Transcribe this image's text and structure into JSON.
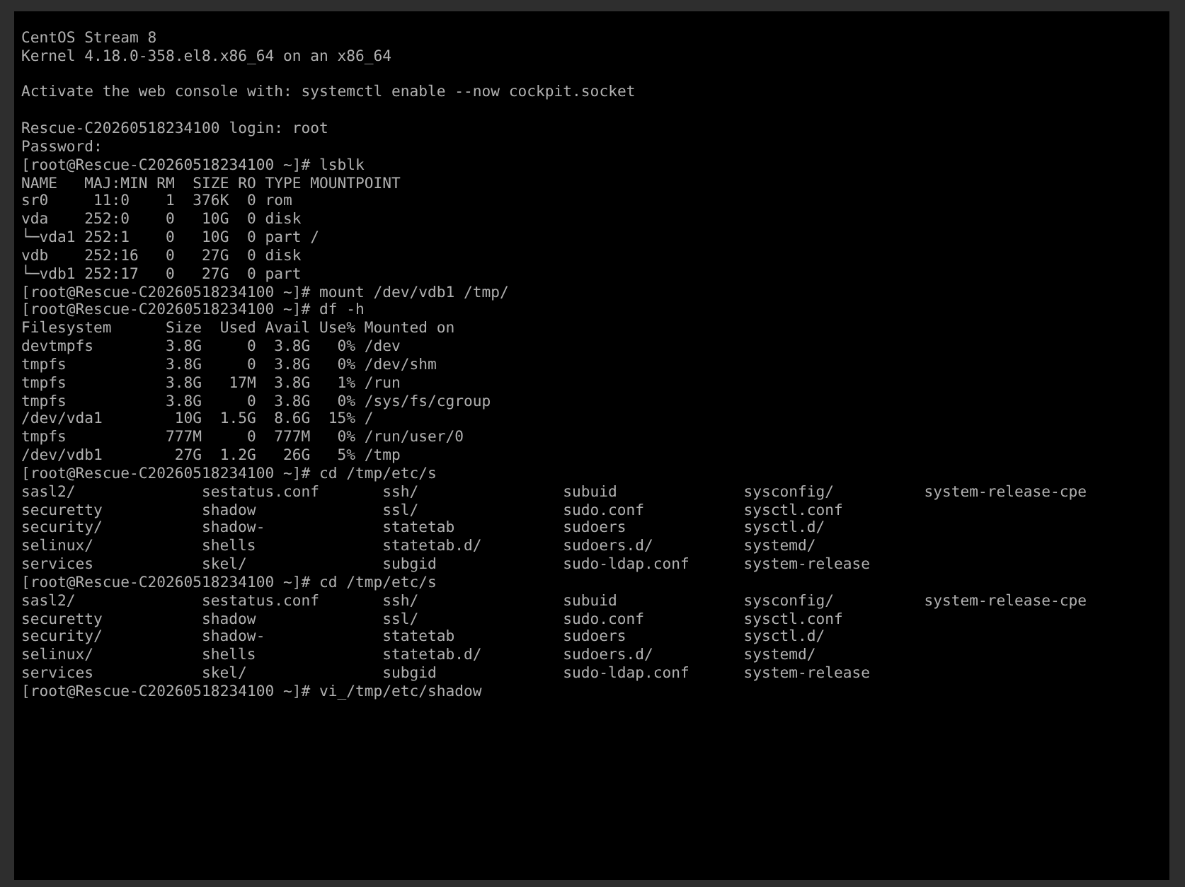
{
  "terminal": {
    "blocks": [
      [
        {
          "kind": "text",
          "text": "CentOS Stream 8"
        },
        {
          "kind": "text",
          "text": "Kernel 4.18.0-358.el8.x86_64 on an x86_64"
        }
      ],
      [
        {
          "kind": "text",
          "text": "Activate the web console with: systemctl enable --now cockpit.socket"
        }
      ],
      [
        {
          "kind": "text",
          "text": "Rescue-C20260518234100 login: root"
        },
        {
          "kind": "text",
          "text": "Password:"
        },
        {
          "kind": "text",
          "text": "[root@Rescue-C20260518234100 ~]# lsblk"
        },
        {
          "kind": "text",
          "text": "NAME   MAJ:MIN RM  SIZE RO TYPE MOUNTPOINT"
        },
        {
          "kind": "text",
          "text": "sr0     11:0    1  376K  0 rom"
        },
        {
          "kind": "text",
          "text": "vda    252:0    0   10G  0 disk"
        },
        {
          "kind": "text",
          "text": "└─vda1 252:1    0   10G  0 part /"
        },
        {
          "kind": "text",
          "text": "vdb    252:16   0   27G  0 disk"
        },
        {
          "kind": "text",
          "text": "└─vdb1 252:17   0   27G  0 part"
        },
        {
          "kind": "text",
          "text": "[root@Rescue-C20260518234100 ~]# mount /dev/vdb1 /tmp/"
        },
        {
          "kind": "text",
          "text": "[root@Rescue-C20260518234100 ~]# df -h"
        },
        {
          "kind": "text",
          "text": "Filesystem      Size  Used Avail Use% Mounted on"
        },
        {
          "kind": "text",
          "text": "devtmpfs        3.8G     0  3.8G   0% /dev"
        },
        {
          "kind": "text",
          "text": "tmpfs           3.8G     0  3.8G   0% /dev/shm"
        },
        {
          "kind": "text",
          "text": "tmpfs           3.8G   17M  3.8G   1% /run"
        },
        {
          "kind": "text",
          "text": "tmpfs           3.8G     0  3.8G   0% /sys/fs/cgroup"
        },
        {
          "kind": "text",
          "text": "/dev/vda1        10G  1.5G  8.6G  15% /"
        },
        {
          "kind": "text",
          "text": "tmpfs           777M     0  777M   0% /run/user/0"
        },
        {
          "kind": "text",
          "text": "/dev/vdb1        27G  1.2G   26G   5% /tmp"
        },
        {
          "kind": "text",
          "text": "[root@Rescue-C20260518234100 ~]# cd /tmp/etc/s"
        },
        {
          "kind": "columns",
          "cells": [
            "sasl2/",
            "sestatus.conf",
            "ssh/",
            "subuid",
            "sysconfig/",
            "system-release-cpe"
          ]
        },
        {
          "kind": "columns",
          "cells": [
            "securetty",
            "shadow",
            "ssl/",
            "sudo.conf",
            "sysctl.conf"
          ]
        },
        {
          "kind": "columns",
          "cells": [
            "security/",
            "shadow-",
            "statetab",
            "sudoers",
            "sysctl.d/"
          ]
        },
        {
          "kind": "columns",
          "cells": [
            "selinux/",
            "shells",
            "statetab.d/",
            "sudoers.d/",
            "systemd/"
          ]
        },
        {
          "kind": "columns",
          "cells": [
            "services",
            "skel/",
            "subgid",
            "sudo-ldap.conf",
            "system-release"
          ]
        },
        {
          "kind": "text",
          "text": "[root@Rescue-C20260518234100 ~]# cd /tmp/etc/s"
        },
        {
          "kind": "columns",
          "cells": [
            "sasl2/",
            "sestatus.conf",
            "ssh/",
            "subuid",
            "sysconfig/",
            "system-release-cpe"
          ]
        },
        {
          "kind": "columns",
          "cells": [
            "securetty",
            "shadow",
            "ssl/",
            "sudo.conf",
            "sysctl.conf"
          ]
        },
        {
          "kind": "columns",
          "cells": [
            "security/",
            "shadow-",
            "statetab",
            "sudoers",
            "sysctl.d/"
          ]
        },
        {
          "kind": "columns",
          "cells": [
            "selinux/",
            "shells",
            "statetab.d/",
            "sudoers.d/",
            "systemd/"
          ]
        },
        {
          "kind": "columns",
          "cells": [
            "services",
            "skel/",
            "subgid",
            "sudo-ldap.conf",
            "system-release"
          ]
        },
        {
          "kind": "text",
          "text": "[root@Rescue-C20260518234100 ~]# vi_/tmp/etc/shadow"
        }
      ]
    ]
  }
}
